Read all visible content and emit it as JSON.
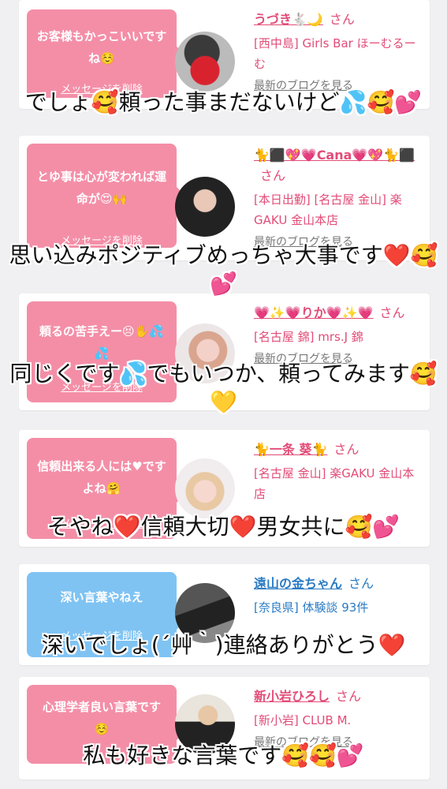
{
  "delete_label": "メッセージを削除",
  "blog_label": "最新のブログを見る",
  "san": "さん",
  "cards": [
    {
      "message": "お客様もかっこいいですね☺️",
      "name": "うづき🐇🌙",
      "shop": "[西中島] Girls Bar ほーむるーむ"
    },
    {
      "message": "とゆ事は心が変われば運命が😍🙌",
      "name": "🐈⬛💖💗Cana💗💖🐈⬛",
      "shop": "[本日出勤] [名古屋 金山] 楽GAKU 金山本店"
    },
    {
      "message": "頼るの苦手えー😣✋💦💦",
      "name": "💗✨💗りか💗✨💗",
      "shop": "[名古屋 錦] mrs.J 錦"
    },
    {
      "message": "信頼出来る人には♥ですよね🤗",
      "name": "🐈一条 葵🐈",
      "shop": "[名古屋 金山] 楽GAKU 金山本店"
    },
    {
      "message": "深い言葉やねえ",
      "name": "遠山の金ちゃん",
      "shop": "[奈良県] 体験談 93件"
    },
    {
      "message": "心理学者良い言葉です☺️",
      "name": "新小岩ひろし",
      "shop": "[新小岩] CLUB M."
    }
  ],
  "overlays": [
    "でしょ🥰頼った事まだないけど💦🥰💕",
    "思い込みポジティブめっちゃ大事です❤️🥰💕",
    "同じくです💦でもいつか、頼ってみます🥰💛",
    "そやね❤️信頼大切❤️男女共に🥰💕",
    "深いでしょ(´艸｀)連絡ありがとう❤️",
    "私も好きな言葉です🥰🥰💕"
  ]
}
